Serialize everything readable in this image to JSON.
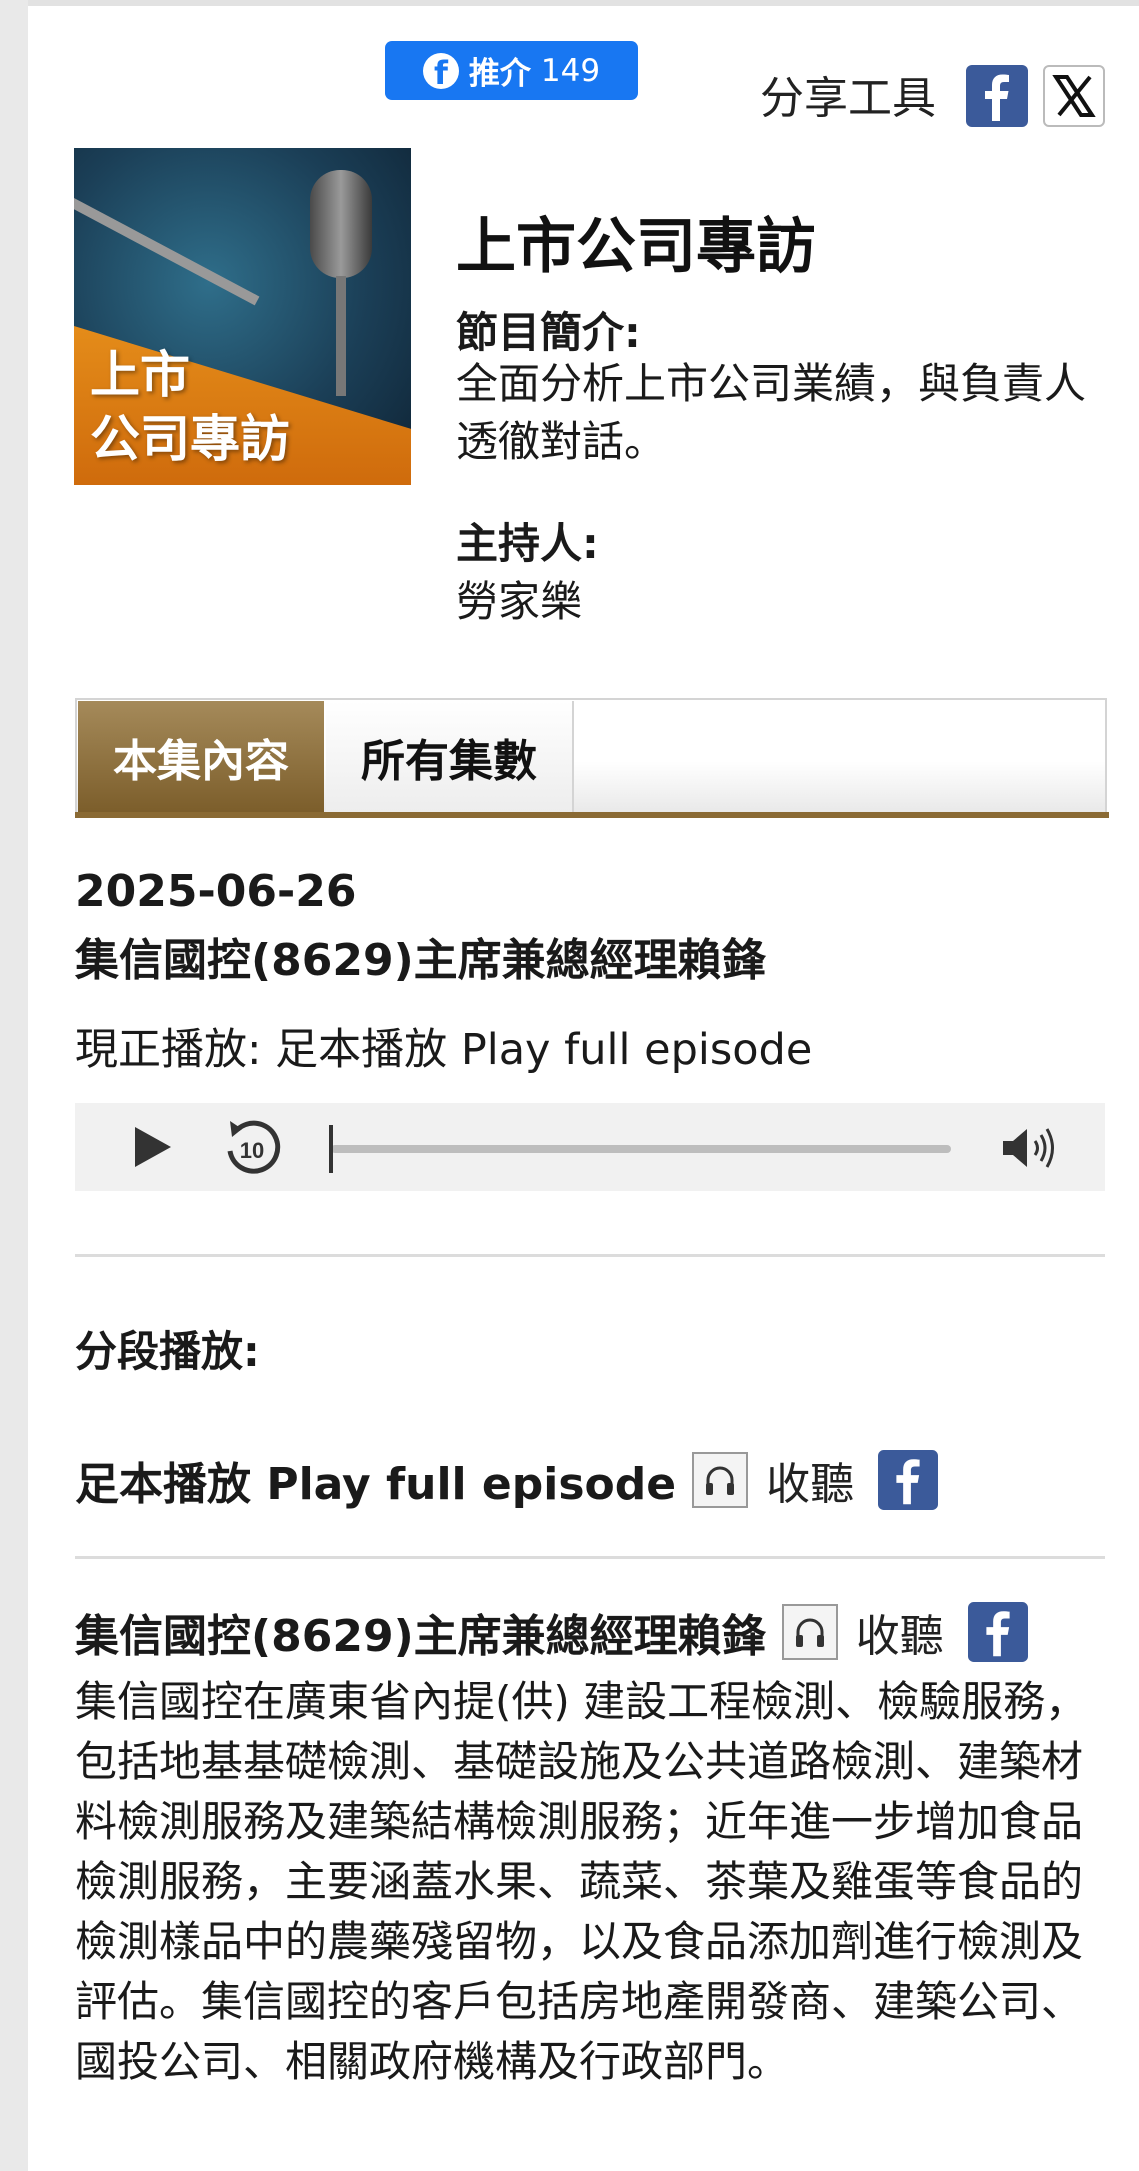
{
  "social": {
    "like_label": "推介",
    "like_count": "149",
    "share_label": "分享工具"
  },
  "program": {
    "cover_text": "上市\n公司專訪",
    "title": "上市公司專訪",
    "desc_label": "節目簡介:",
    "desc_text": "全面分析上市公司業績，與負責人透徹對話。",
    "host_label": "主持人:",
    "host_name": "勞家樂"
  },
  "tabs": [
    {
      "label": "本集內容",
      "active": true
    },
    {
      "label": "所有集數",
      "active": false
    }
  ],
  "episode": {
    "date": "2025-06-26",
    "title": "集信國控(8629)主席兼總經理賴鋒",
    "now_playing": "現正播放: 足本播放 Play full episode"
  },
  "player": {
    "progress": 0,
    "replay_seconds": "10"
  },
  "segments": {
    "label": "分段播放:",
    "items": [
      {
        "title": "足本播放 Play full episode",
        "listen_label": "收聽"
      },
      {
        "title": "集信國控(8629)主席兼總經理賴鋒",
        "listen_label": "收聽",
        "description": "集信國控在廣東省內提(供) 建設工程檢測、檢驗服務，包括地基基礎檢測、基礎設施及公共道路檢測、建築材料檢測服務及建築結構檢測服務；近年進一步增加食品檢測服務，主要涵蓋水果、蔬菜、茶葉及雞蛋等食品的檢測樣品中的農藥殘留物，以及食品添加劑進行檢測及評估。集信國控的客戶包括房地產開發商、建築公司、國投公司、相關政府機構及行政部門。"
      }
    ]
  },
  "colors": {
    "facebook_blue": "#1877f2",
    "tab_active": "#8a6a34"
  }
}
